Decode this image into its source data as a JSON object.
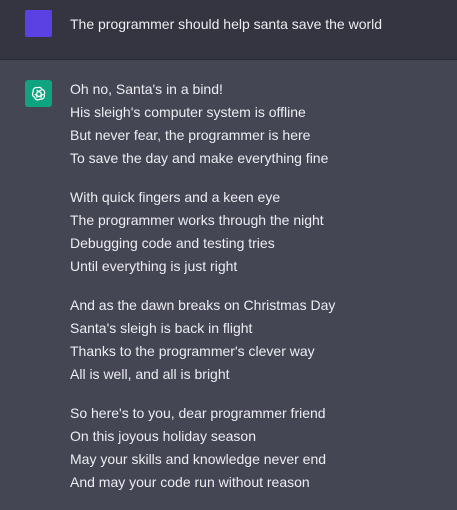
{
  "colors": {
    "user_bg": "#343541",
    "assistant_bg": "#444654",
    "user_avatar": "#5b41e4",
    "assistant_avatar": "#10a37f",
    "text": "#ececf1"
  },
  "user_message": {
    "avatar_icon": "user-avatar",
    "text": "The programmer should help santa save the world"
  },
  "assistant_message": {
    "avatar_icon": "openai-logo-icon",
    "stanzas": [
      {
        "lines": [
          "Oh no, Santa's in a bind!",
          "His sleigh's computer system is offline",
          "But never fear, the programmer is here",
          "To save the day and make everything fine"
        ]
      },
      {
        "lines": [
          "With quick fingers and a keen eye",
          "The programmer works through the night",
          "Debugging code and testing tries",
          "Until everything is just right"
        ]
      },
      {
        "lines": [
          "And as the dawn breaks on Christmas Day",
          "Santa's sleigh is back in flight",
          "Thanks to the programmer's clever way",
          "All is well, and all is bright"
        ]
      },
      {
        "lines": [
          "So here's to you, dear programmer friend",
          "On this joyous holiday season",
          "May your skills and knowledge never end",
          "And may your code run without reason"
        ]
      }
    ]
  }
}
